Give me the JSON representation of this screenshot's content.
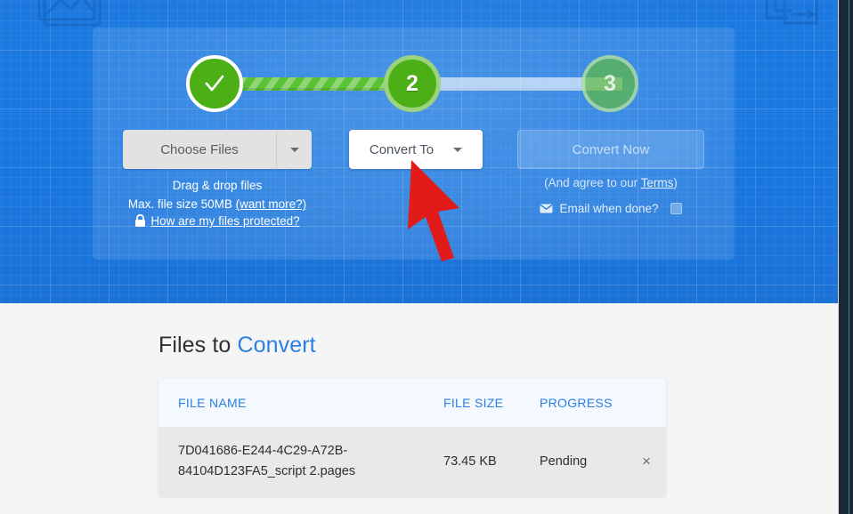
{
  "hero": {
    "decorations": [
      {
        "name": "image-placeholder-icon"
      },
      {
        "name": "document-pages-icon"
      }
    ],
    "stepper": {
      "steps": [
        {
          "name": "step-1",
          "label": "✓",
          "state": "complete"
        },
        {
          "name": "step-2",
          "label": "2",
          "state": "active"
        },
        {
          "name": "step-3",
          "label": "3",
          "state": "upcoming"
        }
      ],
      "bar_complete_color": "#5bc236",
      "bar_upcoming_color": "#ffffff",
      "step_complete_color": "#4caf16"
    },
    "choose_files": {
      "label": "Choose Files",
      "caret_icon": "chevron-down-icon",
      "drag_drop_text": "Drag & drop files",
      "max_size_text": "Max. file size 50MB",
      "want_more_label": "(want more?)",
      "lock_icon": "lock-icon",
      "protected_label": "How are my files protected?"
    },
    "convert_to": {
      "label": "Convert To",
      "caret_icon": "chevron-down-icon"
    },
    "convert_now": {
      "label": "Convert Now",
      "terms_prefix": "(And agree to our ",
      "terms_link": "Terms",
      "terms_suffix": ")",
      "email_icon": "envelope-icon",
      "email_label": "Email when done?",
      "email_checked": false
    }
  },
  "pointer": {
    "name": "red-arrow-cursor",
    "color": "#e01b19",
    "target": "Convert To"
  },
  "files": {
    "title_prefix": "Files to ",
    "title_accent": "Convert",
    "columns": {
      "name": "FILE NAME",
      "size": "FILE SIZE",
      "progress": "PROGRESS",
      "action": ""
    },
    "rows": [
      {
        "name": "7D041686-E244-4C29-A72B-84104D123FA5_script 2.pages",
        "size": "73.45 KB",
        "progress": "Pending",
        "remove_icon": "×"
      }
    ]
  },
  "scrollbar": {
    "name": "vertical-scrollbar",
    "thumb_position": "top"
  },
  "colors": {
    "hero_blue": "#1977e0",
    "accent_blue": "#2a7fe0",
    "green": "#4caf16",
    "arrow_red": "#e01b19"
  }
}
